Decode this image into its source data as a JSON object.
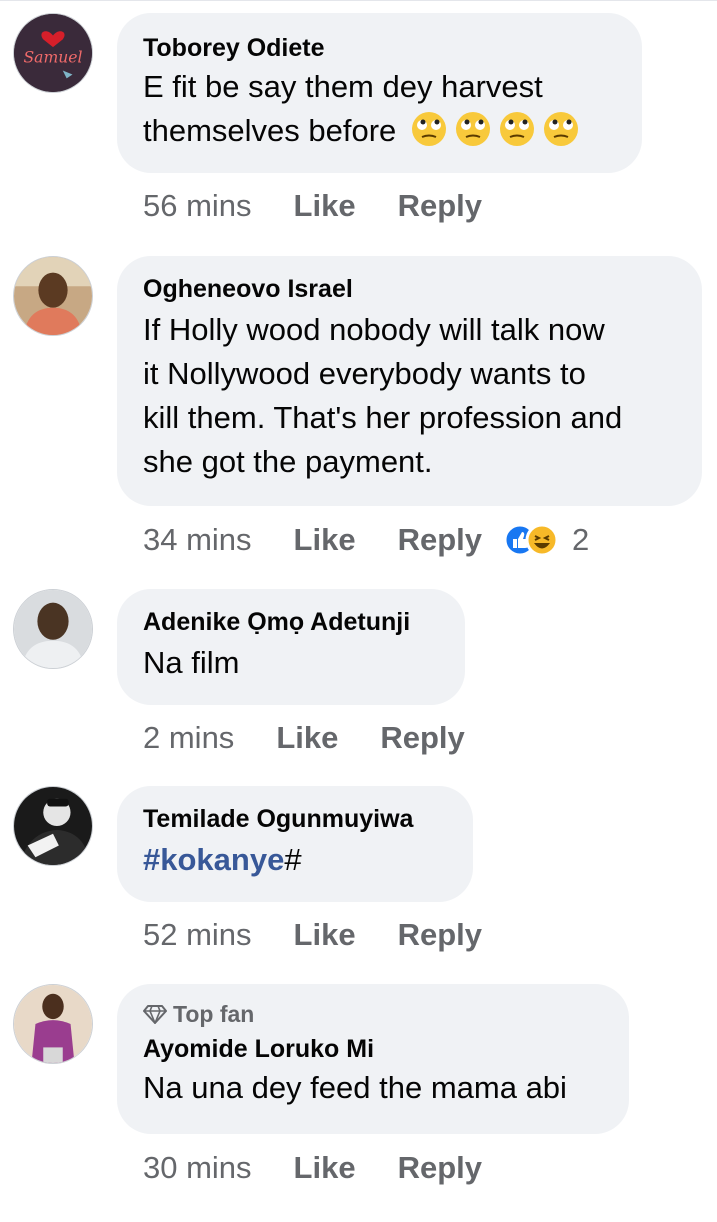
{
  "comments": [
    {
      "author": "Toborey Odiete",
      "text_line1": "E fit be say them dey harvest",
      "text_line2": "themselves before",
      "emoji": "eye-roll-face-icon",
      "time": "56 mins",
      "like": "Like",
      "reply": "Reply"
    },
    {
      "author": "Ogheneovo Israel",
      "text_lines": [
        "If Holly wood nobody will talk now",
        "it Nollywood everybody wants to",
        "kill them. That's her profession and",
        "she got the payment."
      ],
      "time": "34 mins",
      "like": "Like",
      "reply": "Reply",
      "reactions": [
        "like-icon",
        "haha-icon"
      ],
      "reaction_count": "2"
    },
    {
      "author": "Adenike Ọmọ Adetunji",
      "text": "Na film",
      "time": "2 mins",
      "like": "Like",
      "reply": "Reply"
    },
    {
      "author": "Temilade Ogunmuyiwa",
      "hashtag": "#kokanye",
      "text_after": "#",
      "time": "52 mins",
      "like": "Like",
      "reply": "Reply"
    },
    {
      "badge": "Top fan",
      "author": "Ayomide Loruko Mi",
      "text": "Na una dey feed the mama abi",
      "time": "30 mins",
      "like": "Like",
      "reply": "Reply"
    }
  ],
  "avatar_lettering": "Samuel",
  "colors": {
    "bubble": "#f0f2f5",
    "meta": "#65676b",
    "hashtag": "#385898",
    "like": "#1877f2"
  }
}
